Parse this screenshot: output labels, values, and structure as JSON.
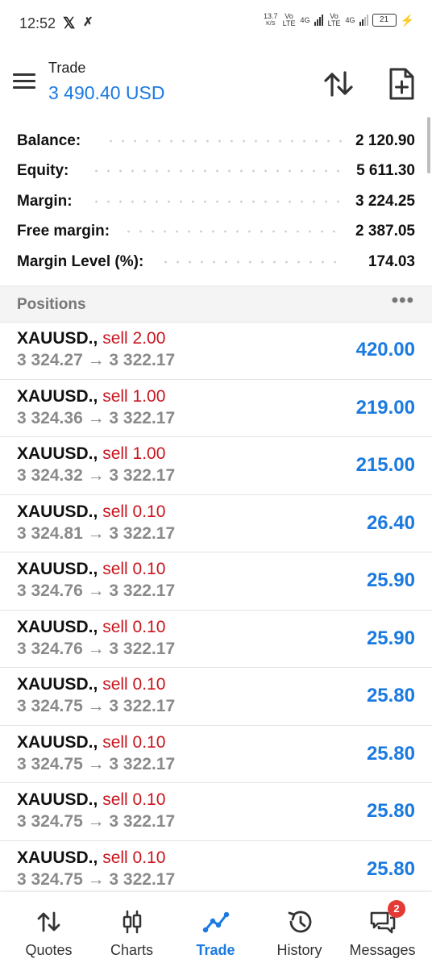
{
  "status_bar": {
    "time": "12:52",
    "app_icons": [
      "x-icon",
      "n-icon"
    ],
    "net_speed": "13.7",
    "net_unit": "K/S",
    "sim1": "Vo LTE",
    "sim1_tech": "4G",
    "sim2": "Vo LTE",
    "sim2_tech": "4G",
    "battery": "21"
  },
  "header": {
    "title": "Trade",
    "amount": "3 490.40 USD"
  },
  "summary": [
    {
      "label": "Balance:",
      "value": "2 120.90"
    },
    {
      "label": "Equity:",
      "value": "5 611.30"
    },
    {
      "label": "Margin:",
      "value": "3 224.25"
    },
    {
      "label": "Free margin:",
      "value": "2 387.05"
    },
    {
      "label": "Margin Level (%):",
      "value": "174.03"
    }
  ],
  "positions_section": {
    "title": "Positions",
    "more": "•••"
  },
  "positions": [
    {
      "symbol": "XAUUSD.,",
      "side": "sell 2.00",
      "prices": "3 324.27 → 3 322.17",
      "profit": "420.00"
    },
    {
      "symbol": "XAUUSD.,",
      "side": "sell 1.00",
      "prices": "3 324.36 → 3 322.17",
      "profit": "219.00"
    },
    {
      "symbol": "XAUUSD.,",
      "side": "sell 1.00",
      "prices": "3 324.32 → 3 322.17",
      "profit": "215.00"
    },
    {
      "symbol": "XAUUSD.,",
      "side": "sell 0.10",
      "prices": "3 324.81 → 3 322.17",
      "profit": "26.40"
    },
    {
      "symbol": "XAUUSD.,",
      "side": "sell 0.10",
      "prices": "3 324.76 → 3 322.17",
      "profit": "25.90"
    },
    {
      "symbol": "XAUUSD.,",
      "side": "sell 0.10",
      "prices": "3 324.76 → 3 322.17",
      "profit": "25.90"
    },
    {
      "symbol": "XAUUSD.,",
      "side": "sell 0.10",
      "prices": "3 324.75 → 3 322.17",
      "profit": "25.80"
    },
    {
      "symbol": "XAUUSD.,",
      "side": "sell 0.10",
      "prices": "3 324.75 → 3 322.17",
      "profit": "25.80"
    },
    {
      "symbol": "XAUUSD.,",
      "side": "sell 0.10",
      "prices": "3 324.75 → 3 322.17",
      "profit": "25.80"
    },
    {
      "symbol": "XAUUSD.,",
      "side": "sell 0.10",
      "prices": "3 324.75 → 3 322.17",
      "profit": "25.80"
    }
  ],
  "bottom_nav": [
    {
      "label": "Quotes",
      "icon": "quotes-icon",
      "active": false
    },
    {
      "label": "Charts",
      "icon": "charts-icon",
      "active": false
    },
    {
      "label": "Trade",
      "icon": "trade-icon",
      "active": true
    },
    {
      "label": "History",
      "icon": "history-icon",
      "active": false
    },
    {
      "label": "Messages",
      "icon": "messages-icon",
      "active": false,
      "badge": "2"
    }
  ],
  "colors": {
    "accent": "#1b7ae0",
    "sell": "#c9151e",
    "badge": "#e53935"
  }
}
